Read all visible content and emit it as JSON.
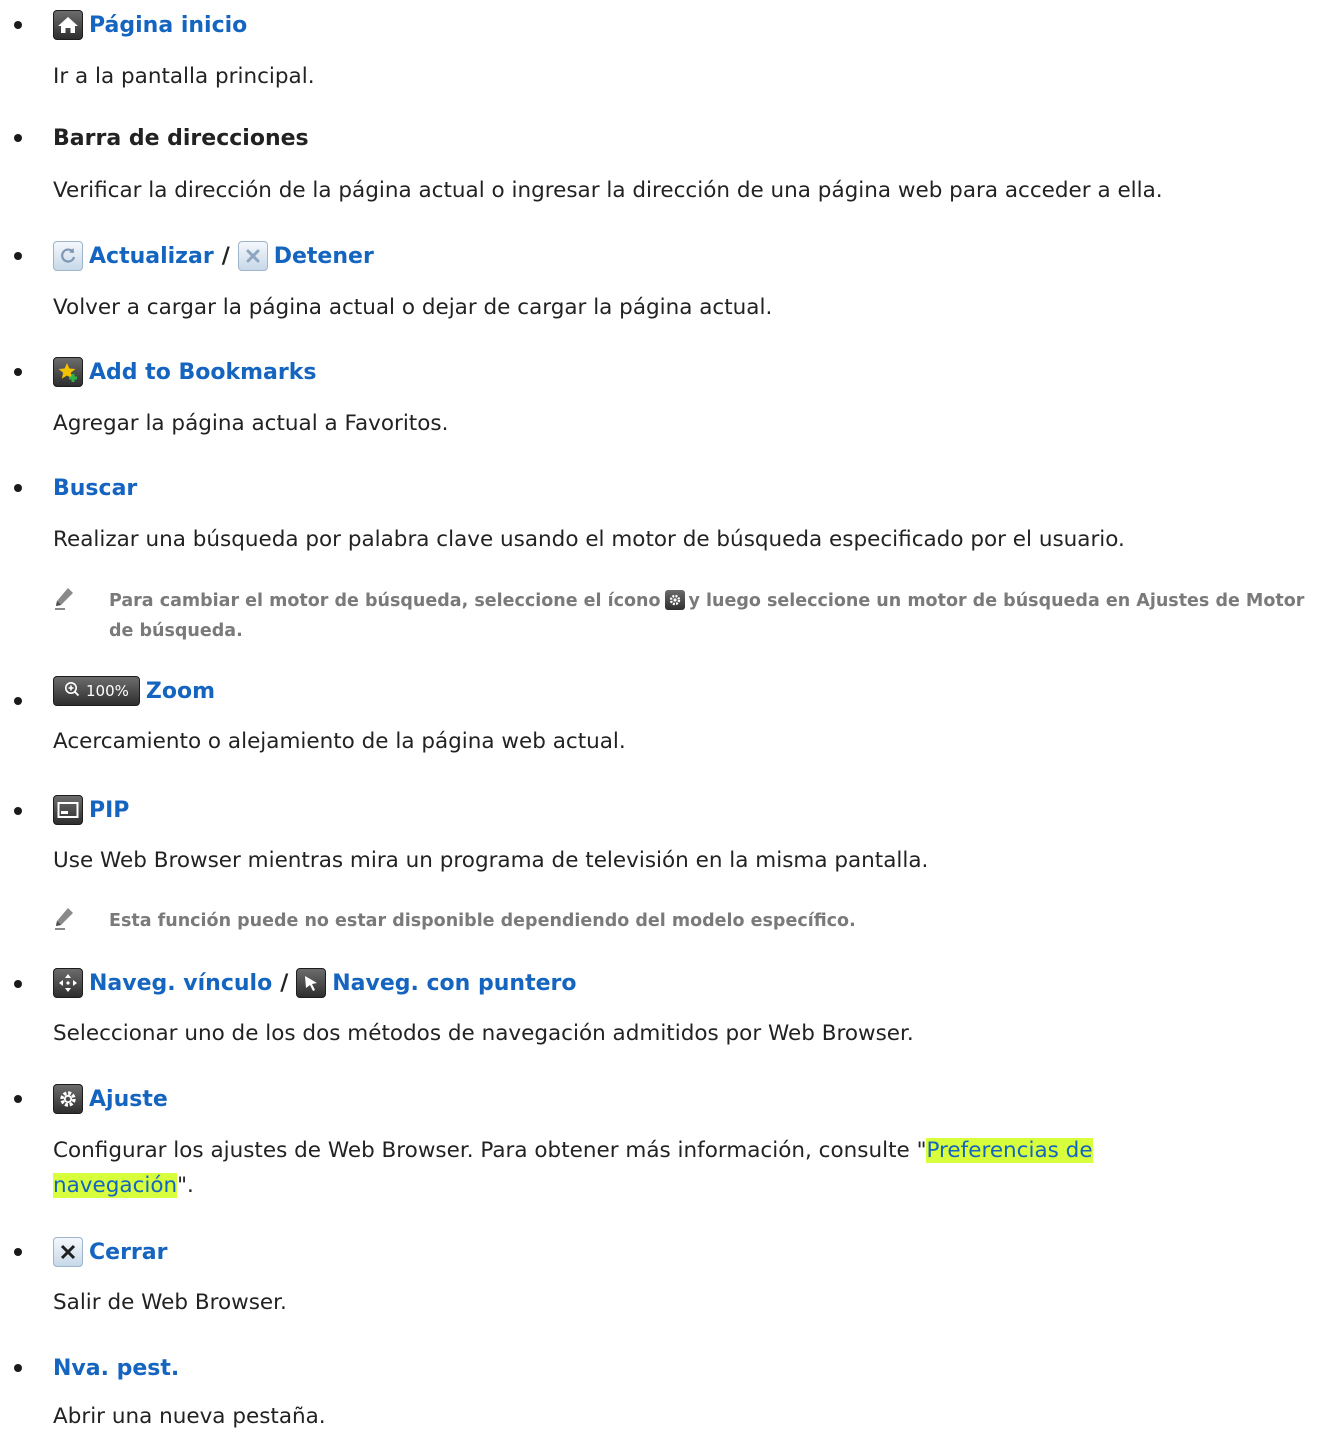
{
  "items": [
    {
      "icon": "home-icon",
      "title": "Página inicio",
      "desc": "Ir a la pantalla principal."
    },
    {
      "title": "Barra de direcciones",
      "desc": "Verificar la dirección de la página actual o ingresar la dirección de una página web para acceder a ella."
    },
    {
      "icon": "refresh-icon",
      "title": "Actualizar",
      "sep": "/",
      "icon2": "stop-icon",
      "title2": "Detener",
      "desc": "Volver a cargar la página actual o dejar de cargar la página actual."
    },
    {
      "icon": "bookmark-star-icon",
      "title": "Add to Bookmarks",
      "desc": "Agregar la página actual a Favoritos."
    },
    {
      "title": "Buscar",
      "desc": "Realizar una búsqueda por palabra clave usando el motor de búsqueda especificado por el usuario.",
      "note_before": "Para cambiar el motor de búsqueda, seleccione el ícono",
      "note_after": "y luego seleccione un motor de búsqueda en Ajustes de Motor de búsqueda."
    },
    {
      "icon": "zoom-icon",
      "zoom_value": "100%",
      "title": "Zoom",
      "desc": "Acercamiento o alejamiento de la página web actual."
    },
    {
      "icon": "pip-icon",
      "title": "PIP",
      "desc": "Use Web Browser mientras mira un programa de televisión en la misma pantalla.",
      "note": "Esta función puede no estar disponible dependiendo del modelo específico."
    },
    {
      "icon": "link-navigation-icon",
      "title": "Naveg. vínculo",
      "sep": "/",
      "icon2": "pointer-navigation-icon",
      "title2": "Naveg. con puntero",
      "desc": "Seleccionar uno de los dos métodos de navegación admitidos por Web Browser."
    },
    {
      "icon": "gear-icon",
      "title": "Ajuste",
      "desc_before": "Configurar los ajustes de Web Browser. Para obtener más información, consulte \"",
      "link": "Preferencias de navegación",
      "desc_after": "\"."
    },
    {
      "icon": "close-icon",
      "title": "Cerrar",
      "desc": "Salir de Web Browser."
    },
    {
      "title": "Nva. pest.",
      "desc": "Abrir una nueva pestaña."
    }
  ],
  "colors": {
    "heading": "#1565c0",
    "note": "#7a7a7a",
    "highlight": "#d7ff3c"
  }
}
